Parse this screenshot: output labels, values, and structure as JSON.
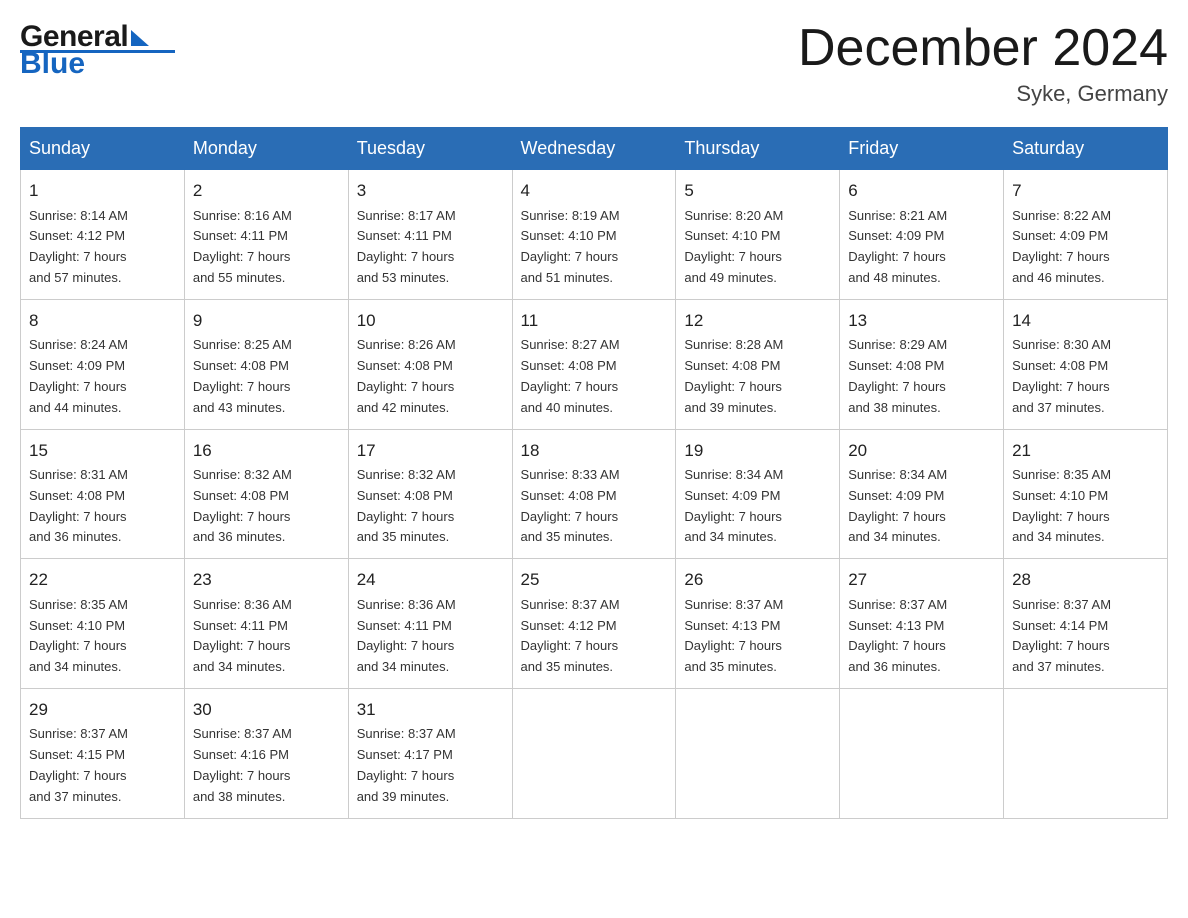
{
  "header": {
    "logo_general": "General",
    "logo_blue": "Blue",
    "title": "December 2024",
    "subtitle": "Syke, Germany"
  },
  "days_of_week": [
    "Sunday",
    "Monday",
    "Tuesday",
    "Wednesday",
    "Thursday",
    "Friday",
    "Saturday"
  ],
  "weeks": [
    {
      "days": [
        {
          "num": "1",
          "sunrise": "8:14 AM",
          "sunset": "4:12 PM",
          "daylight": "7 hours and 57 minutes."
        },
        {
          "num": "2",
          "sunrise": "8:16 AM",
          "sunset": "4:11 PM",
          "daylight": "7 hours and 55 minutes."
        },
        {
          "num": "3",
          "sunrise": "8:17 AM",
          "sunset": "4:11 PM",
          "daylight": "7 hours and 53 minutes."
        },
        {
          "num": "4",
          "sunrise": "8:19 AM",
          "sunset": "4:10 PM",
          "daylight": "7 hours and 51 minutes."
        },
        {
          "num": "5",
          "sunrise": "8:20 AM",
          "sunset": "4:10 PM",
          "daylight": "7 hours and 49 minutes."
        },
        {
          "num": "6",
          "sunrise": "8:21 AM",
          "sunset": "4:09 PM",
          "daylight": "7 hours and 48 minutes."
        },
        {
          "num": "7",
          "sunrise": "8:22 AM",
          "sunset": "4:09 PM",
          "daylight": "7 hours and 46 minutes."
        }
      ]
    },
    {
      "days": [
        {
          "num": "8",
          "sunrise": "8:24 AM",
          "sunset": "4:09 PM",
          "daylight": "7 hours and 44 minutes."
        },
        {
          "num": "9",
          "sunrise": "8:25 AM",
          "sunset": "4:08 PM",
          "daylight": "7 hours and 43 minutes."
        },
        {
          "num": "10",
          "sunrise": "8:26 AM",
          "sunset": "4:08 PM",
          "daylight": "7 hours and 42 minutes."
        },
        {
          "num": "11",
          "sunrise": "8:27 AM",
          "sunset": "4:08 PM",
          "daylight": "7 hours and 40 minutes."
        },
        {
          "num": "12",
          "sunrise": "8:28 AM",
          "sunset": "4:08 PM",
          "daylight": "7 hours and 39 minutes."
        },
        {
          "num": "13",
          "sunrise": "8:29 AM",
          "sunset": "4:08 PM",
          "daylight": "7 hours and 38 minutes."
        },
        {
          "num": "14",
          "sunrise": "8:30 AM",
          "sunset": "4:08 PM",
          "daylight": "7 hours and 37 minutes."
        }
      ]
    },
    {
      "days": [
        {
          "num": "15",
          "sunrise": "8:31 AM",
          "sunset": "4:08 PM",
          "daylight": "7 hours and 36 minutes."
        },
        {
          "num": "16",
          "sunrise": "8:32 AM",
          "sunset": "4:08 PM",
          "daylight": "7 hours and 36 minutes."
        },
        {
          "num": "17",
          "sunrise": "8:32 AM",
          "sunset": "4:08 PM",
          "daylight": "7 hours and 35 minutes."
        },
        {
          "num": "18",
          "sunrise": "8:33 AM",
          "sunset": "4:08 PM",
          "daylight": "7 hours and 35 minutes."
        },
        {
          "num": "19",
          "sunrise": "8:34 AM",
          "sunset": "4:09 PM",
          "daylight": "7 hours and 34 minutes."
        },
        {
          "num": "20",
          "sunrise": "8:34 AM",
          "sunset": "4:09 PM",
          "daylight": "7 hours and 34 minutes."
        },
        {
          "num": "21",
          "sunrise": "8:35 AM",
          "sunset": "4:10 PM",
          "daylight": "7 hours and 34 minutes."
        }
      ]
    },
    {
      "days": [
        {
          "num": "22",
          "sunrise": "8:35 AM",
          "sunset": "4:10 PM",
          "daylight": "7 hours and 34 minutes."
        },
        {
          "num": "23",
          "sunrise": "8:36 AM",
          "sunset": "4:11 PM",
          "daylight": "7 hours and 34 minutes."
        },
        {
          "num": "24",
          "sunrise": "8:36 AM",
          "sunset": "4:11 PM",
          "daylight": "7 hours and 34 minutes."
        },
        {
          "num": "25",
          "sunrise": "8:37 AM",
          "sunset": "4:12 PM",
          "daylight": "7 hours and 35 minutes."
        },
        {
          "num": "26",
          "sunrise": "8:37 AM",
          "sunset": "4:13 PM",
          "daylight": "7 hours and 35 minutes."
        },
        {
          "num": "27",
          "sunrise": "8:37 AM",
          "sunset": "4:13 PM",
          "daylight": "7 hours and 36 minutes."
        },
        {
          "num": "28",
          "sunrise": "8:37 AM",
          "sunset": "4:14 PM",
          "daylight": "7 hours and 37 minutes."
        }
      ]
    },
    {
      "days": [
        {
          "num": "29",
          "sunrise": "8:37 AM",
          "sunset": "4:15 PM",
          "daylight": "7 hours and 37 minutes."
        },
        {
          "num": "30",
          "sunrise": "8:37 AM",
          "sunset": "4:16 PM",
          "daylight": "7 hours and 38 minutes."
        },
        {
          "num": "31",
          "sunrise": "8:37 AM",
          "sunset": "4:17 PM",
          "daylight": "7 hours and 39 minutes."
        },
        null,
        null,
        null,
        null
      ]
    }
  ],
  "labels": {
    "sunrise": "Sunrise:",
    "sunset": "Sunset:",
    "daylight": "Daylight:"
  },
  "colors": {
    "header_bg": "#2a6db5",
    "border": "#ccc",
    "accent": "#1565c0"
  }
}
